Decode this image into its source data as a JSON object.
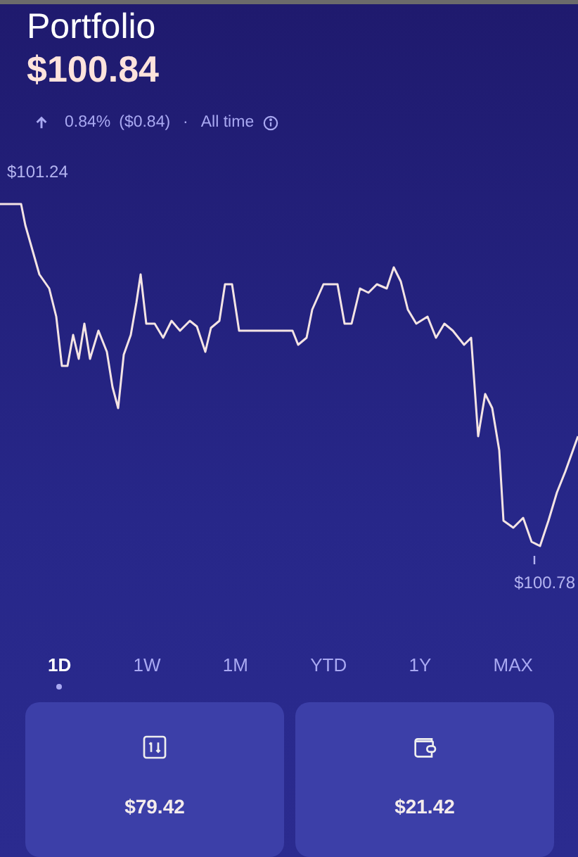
{
  "title": "Portfolio",
  "balance": "$100.84",
  "change": {
    "rising": true,
    "percent": "0.84%",
    "amount": "($0.84)",
    "separator": "·",
    "period": "All time"
  },
  "chart": {
    "high_label": "$101.24",
    "low_label": "$100.78"
  },
  "ranges": [
    {
      "label": "1D",
      "selected": true
    },
    {
      "label": "1W",
      "selected": false
    },
    {
      "label": "1M",
      "selected": false
    },
    {
      "label": "YTD",
      "selected": false
    },
    {
      "label": "1Y",
      "selected": false
    },
    {
      "label": "MAX",
      "selected": false
    }
  ],
  "cards": [
    {
      "kind": "transfer",
      "value": "$79.42"
    },
    {
      "kind": "wallet",
      "value": "$21.42"
    }
  ]
}
